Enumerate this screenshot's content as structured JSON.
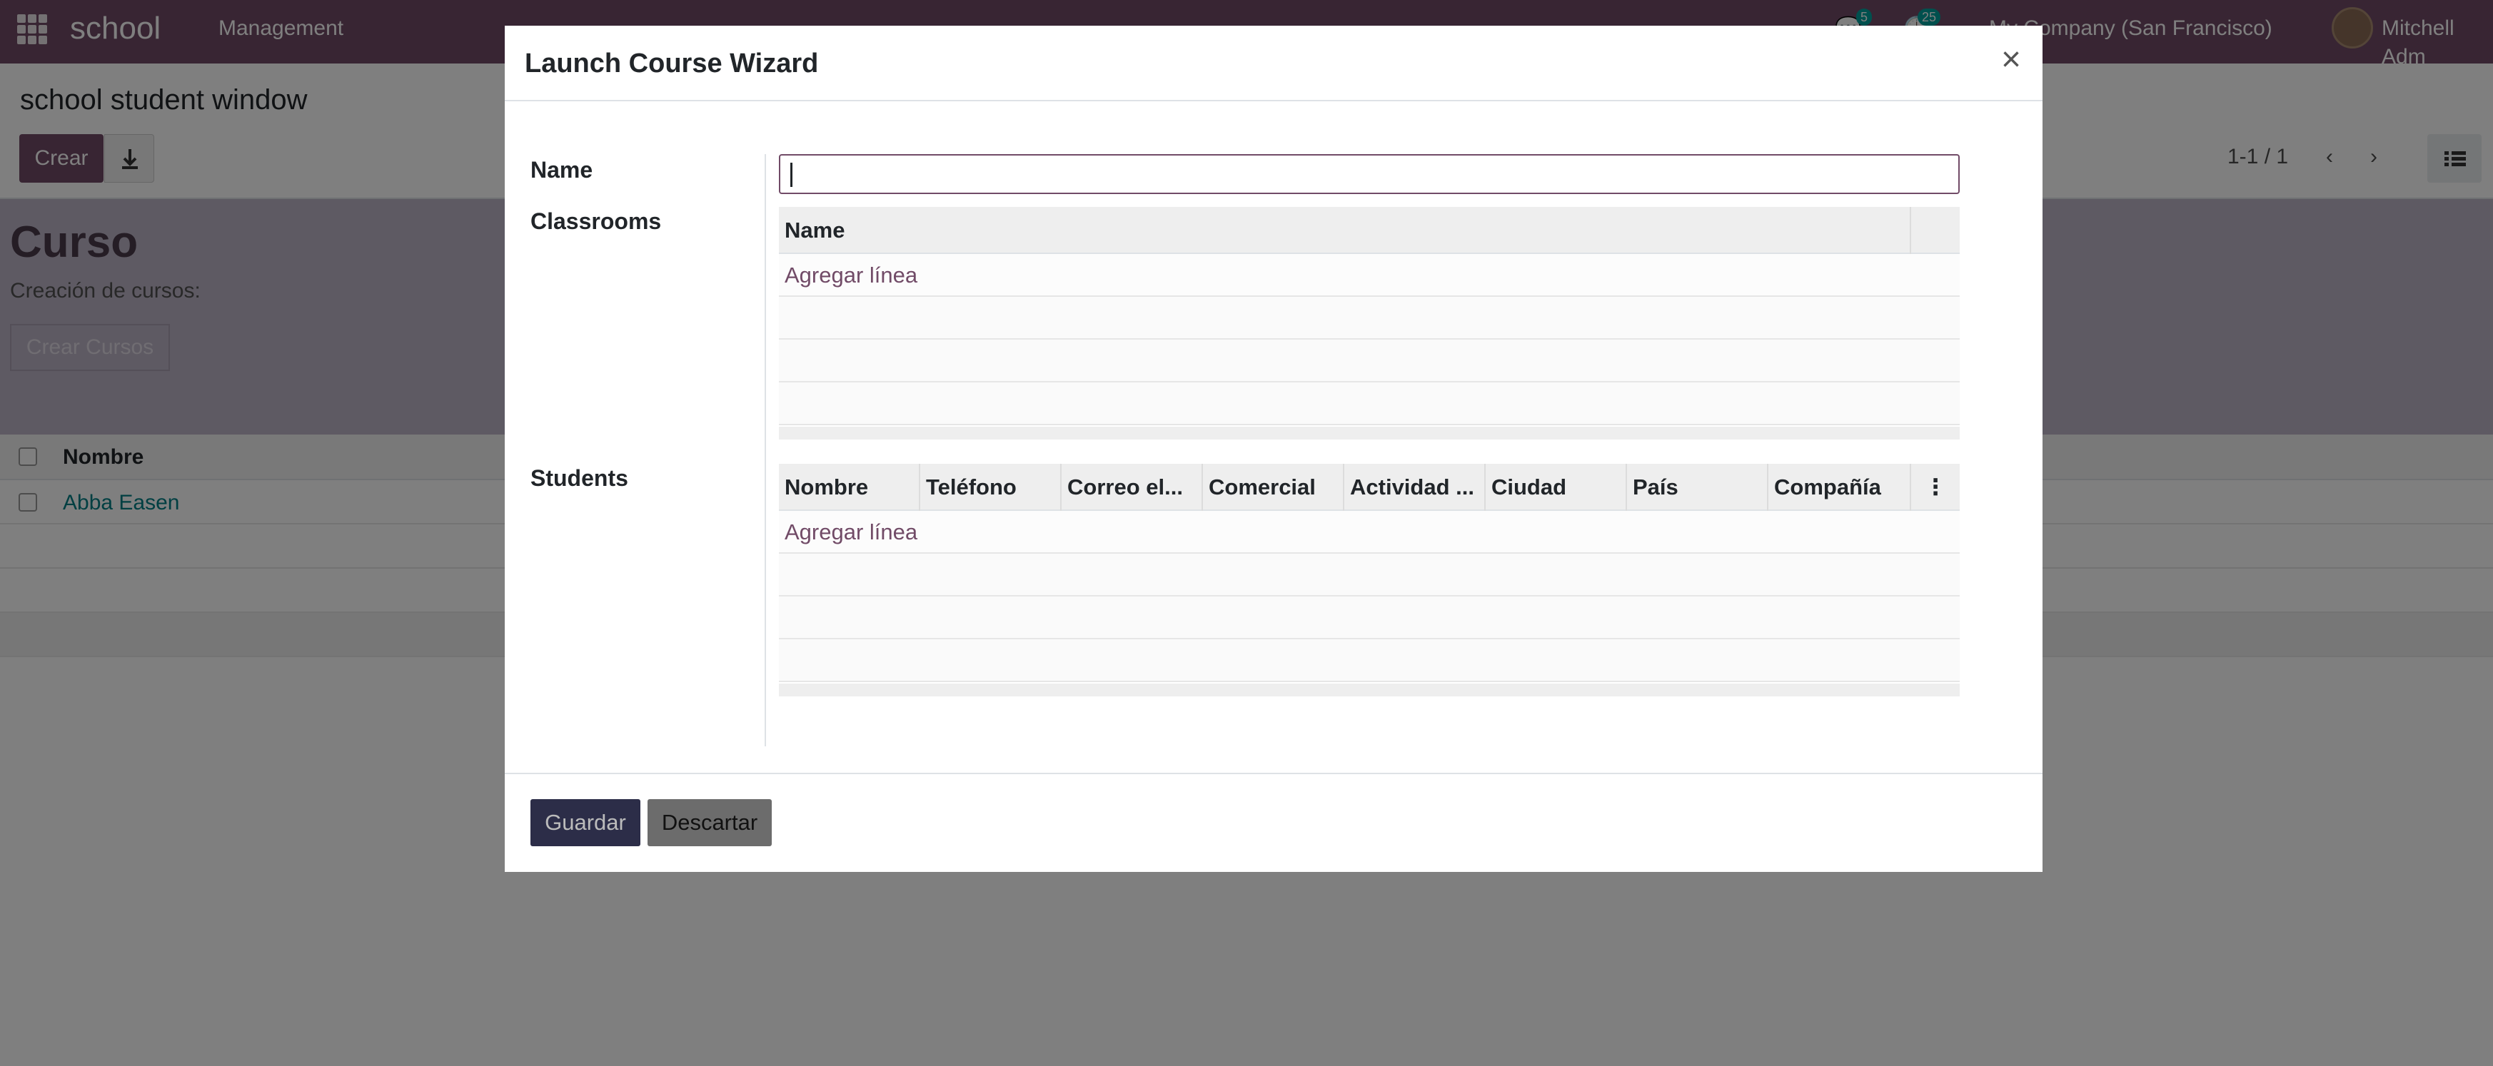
{
  "navbar": {
    "app_name": "school",
    "menu": "Management",
    "messages_count": "5",
    "activities_count": "25",
    "company": "My Company (San Francisco)",
    "user": "Mitchell Adm"
  },
  "control_panel": {
    "breadcrumb": "school student window",
    "create_label": "Crear",
    "pager": "1-1 / 1"
  },
  "banner": {
    "title": "Curso",
    "subtitle": "Creación de cursos:",
    "button": "Crear Cursos"
  },
  "list": {
    "column": "Nombre",
    "rows": [
      "Abba Easen"
    ]
  },
  "modal": {
    "title": "Launch Course Wizard",
    "fields": {
      "name_label": "Name",
      "name_value": "",
      "classrooms_label": "Classrooms",
      "students_label": "Students"
    },
    "classrooms": {
      "columns": [
        "Name"
      ],
      "add_line": "Agregar línea"
    },
    "students": {
      "columns": [
        "Nombre",
        "Teléfono",
        "Correo el...",
        "Comercial",
        "Actividad ...",
        "Ciudad",
        "País",
        "Compañía"
      ],
      "add_line": "Agregar línea"
    },
    "buttons": {
      "save": "Guardar",
      "discard": "Descartar"
    }
  },
  "colors": {
    "brand": "#714b67",
    "save_button": "#2c2d48"
  }
}
